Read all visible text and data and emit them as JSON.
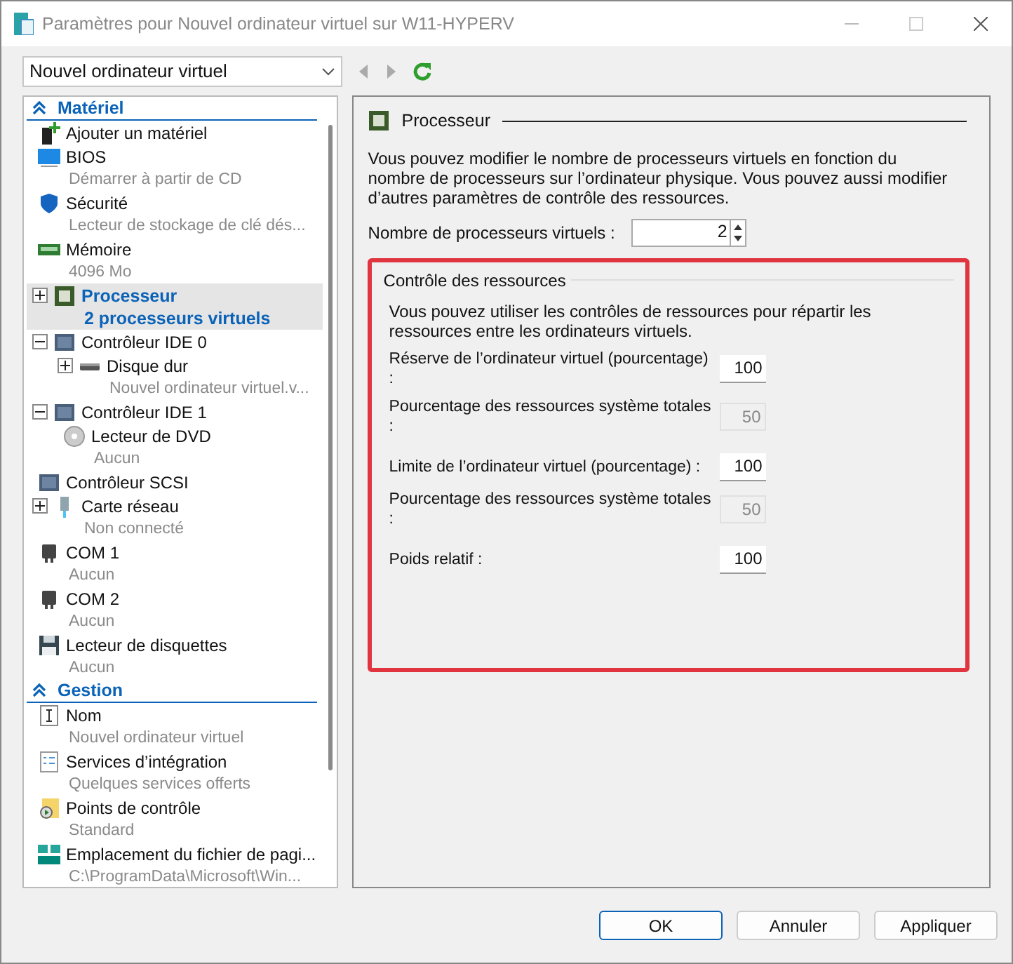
{
  "window": {
    "title": "Paramètres pour Nouvel ordinateur virtuel sur W11-HYPERV"
  },
  "vm_select": {
    "value": "Nouvel ordinateur virtuel"
  },
  "tree": [
    {
      "heading": "Matériel",
      "expanded": true,
      "items": [
        {
          "label": "Ajouter un matériel",
          "selected": false
        },
        {
          "label": "BIOS",
          "sub": "Démarrer à partir de CD",
          "selected": false
        },
        {
          "label": "Sécurité",
          "sub": "Lecteur de stockage de clé dés...",
          "selected": false
        },
        {
          "label": "Mémoire",
          "sub": "4096 Mo",
          "selected": false
        },
        {
          "label": "Processeur",
          "sub": "2 processeurs virtuels",
          "selected": true,
          "expanded": false
        },
        {
          "label": "Contrôleur IDE 0",
          "selected": false,
          "expanded": true,
          "children": [
            {
              "label": "Disque dur",
              "sub": "Nouvel ordinateur virtuel.v...",
              "selected": false,
              "expanded": false
            }
          ]
        },
        {
          "label": "Contrôleur IDE 1",
          "selected": false,
          "expanded": true,
          "children": [
            {
              "label": "Lecteur de DVD",
              "sub": "Aucun",
              "selected": false
            }
          ]
        },
        {
          "label": "Contrôleur SCSI",
          "selected": false
        },
        {
          "label": "Carte réseau",
          "sub": "Non connecté",
          "selected": false,
          "expanded": false
        },
        {
          "label": "COM 1",
          "sub": "Aucun",
          "selected": false
        },
        {
          "label": "COM 2",
          "sub": "Aucun",
          "selected": false
        },
        {
          "label": "Lecteur de disquettes",
          "sub": "Aucun",
          "selected": false
        }
      ]
    },
    {
      "heading": "Gestion",
      "expanded": true,
      "items": [
        {
          "label": "Nom",
          "sub": "Nouvel ordinateur virtuel",
          "selected": false
        },
        {
          "label": "Services d’intégration",
          "sub": "Quelques services offerts",
          "selected": false
        },
        {
          "label": "Points de contrôle",
          "sub": "Standard",
          "selected": false
        },
        {
          "label": "Emplacement du fichier de pagi...",
          "sub": "C:\\ProgramData\\Microsoft\\Win...",
          "selected": false
        }
      ]
    }
  ],
  "panel": {
    "title": "Processeur",
    "description": "Vous pouvez modifier le nombre de processeurs virtuels en fonction du nombre de processeurs sur l’ordinateur physique. Vous pouvez aussi modifier d’autres paramètres de contrôle des ressources.",
    "processor_count": {
      "label": "Nombre de processeurs virtuels :",
      "value": "2"
    },
    "resource_group": {
      "title": "Contrôle des ressources",
      "description": "Vous pouvez utiliser les contrôles de ressources pour répartir les ressources entre les ordinateurs virtuels.",
      "fields": [
        {
          "label": "Réserve de l’ordinateur virtuel (pourcentage) :",
          "value": "100",
          "disabled": false
        },
        {
          "label": "Pourcentage des ressources système totales :",
          "value": "50",
          "disabled": true
        },
        {
          "label": "Limite de l’ordinateur virtuel (pourcentage) :",
          "value": "100",
          "disabled": false
        },
        {
          "label": "Pourcentage des ressources système totales :",
          "value": "50",
          "disabled": true
        },
        {
          "label": "Poids relatif :",
          "value": "100",
          "disabled": false
        }
      ]
    }
  },
  "buttons": [
    {
      "label": "OK",
      "selected": true
    },
    {
      "label": "Annuler",
      "selected": false
    },
    {
      "label": "Appliquer",
      "selected": false
    }
  ]
}
